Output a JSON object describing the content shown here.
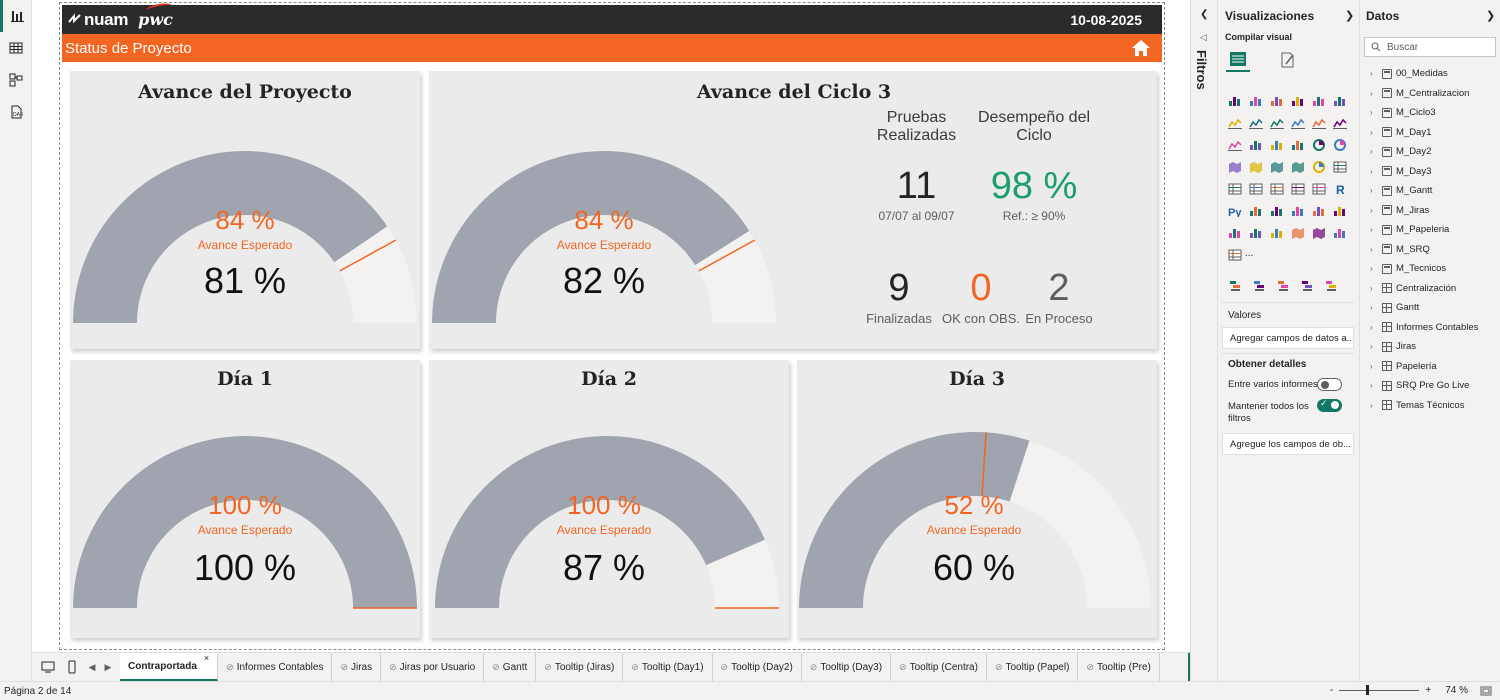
{
  "report": {
    "logo_nuam": "nuam",
    "logo_pwc": "pwc",
    "date": "10-08-2025",
    "subtitle": "Status de Proyecto"
  },
  "cards": {
    "proyecto": {
      "title": "Avance del Proyecto",
      "expected_pct": "84 %",
      "expected_label": "Avance Esperado",
      "actual_pct": "81 %"
    },
    "ciclo3": {
      "title": "Avance del Ciclo 3",
      "expected_pct": "84 %",
      "expected_label": "Avance Esperado",
      "actual_pct": "82 %",
      "pruebas_head": "Pruebas Realizadas",
      "pruebas_value": "11",
      "pruebas_range": "07/07 al 09/07",
      "desempeno_head": "Desempeño del Ciclo",
      "desempeno_value": "98 %",
      "desempeno_ref": "Ref.: ≥ 90%",
      "finalizadas_value": "9",
      "finalizadas_label": "Finalizadas",
      "ok_obs_value": "0",
      "ok_obs_label": "OK con OBS.",
      "en_proceso_value": "2",
      "en_proceso_label": "En Proceso"
    },
    "dia1": {
      "title": "Día 1",
      "expected_pct": "100 %",
      "expected_label": "Avance Esperado",
      "actual_pct": "100 %"
    },
    "dia2": {
      "title": "Día 2",
      "expected_pct": "100 %",
      "expected_label": "Avance Esperado",
      "actual_pct": "87 %"
    },
    "dia3": {
      "title": "Día 3",
      "expected_pct": "52 %",
      "expected_label": "Avance Esperado",
      "actual_pct": "60 %"
    }
  },
  "gauge_levels": {
    "proyecto": {
      "actual": 0.81,
      "expected": 0.84
    },
    "ciclo3": {
      "actual": 0.82,
      "expected": 0.84
    },
    "dia1": {
      "actual": 1.0,
      "expected": 1.0
    },
    "dia2": {
      "actual": 0.87,
      "expected": 1.0
    },
    "dia3": {
      "actual": 0.6,
      "expected": 0.52
    }
  },
  "colors": {
    "gauge_fill": "#a0a4ae",
    "gauge_track": "#f3f2f1",
    "accent": "#f26522",
    "green": "#1a9e6a",
    "teal": "#117865"
  },
  "page_tabs": [
    "Contraportada",
    "Informes Contables",
    "Jiras",
    "Jiras por Usuario",
    "Gantt",
    "Tooltip (Jiras)",
    "Tooltip (Day1)",
    "Tooltip (Day2)",
    "Tooltip (Day3)",
    "Tooltip (Centra)",
    "Tooltip (Papel)",
    "Tooltip (Pre)"
  ],
  "active_tab": "Contraportada",
  "status": {
    "page": "Página 2 de 14",
    "zoom": "74 %",
    "zoom_minus": "-",
    "zoom_plus": "+"
  },
  "filters": {
    "label": "Filtros"
  },
  "visualizations": {
    "title": "Visualizaciones",
    "build_label": "Compilar visual",
    "more": "...",
    "values_label": "Valores",
    "values_placeholder": "Agregar campos de datos a...",
    "drill_label": "Obtener detalles",
    "cross_report_label": "Entre varios informes",
    "keep_filters_label": "Mantener todos los filtros",
    "drill_placeholder": "Agregue los campos de ob...",
    "cross_report_on": false,
    "keep_filters_on": true
  },
  "data": {
    "title": "Datos",
    "search_placeholder": "Buscar",
    "items": [
      {
        "name": "00_Medidas",
        "icon": "calculator-icon"
      },
      {
        "name": "M_Centralizacion",
        "icon": "calculator-icon"
      },
      {
        "name": "M_Ciclo3",
        "icon": "calculator-icon"
      },
      {
        "name": "M_Day1",
        "icon": "calculator-icon"
      },
      {
        "name": "M_Day2",
        "icon": "calculator-icon"
      },
      {
        "name": "M_Day3",
        "icon": "calculator-icon"
      },
      {
        "name": "M_Gantt",
        "icon": "calculator-icon"
      },
      {
        "name": "M_Jiras",
        "icon": "calculator-icon"
      },
      {
        "name": "M_Papeleria",
        "icon": "calculator-icon"
      },
      {
        "name": "M_SRQ",
        "icon": "calculator-icon"
      },
      {
        "name": "M_Tecnicos",
        "icon": "calculator-icon"
      },
      {
        "name": "Centralización",
        "icon": "table-icon"
      },
      {
        "name": "Gantt",
        "icon": "table-icon"
      },
      {
        "name": "Informes Contables",
        "icon": "table-icon"
      },
      {
        "name": "Jiras",
        "icon": "table-icon"
      },
      {
        "name": "Papelería",
        "icon": "table-icon"
      },
      {
        "name": "SRQ Pre Go Live",
        "icon": "table-icon"
      },
      {
        "name": "Temas Técnicos",
        "icon": "table-icon"
      }
    ]
  }
}
